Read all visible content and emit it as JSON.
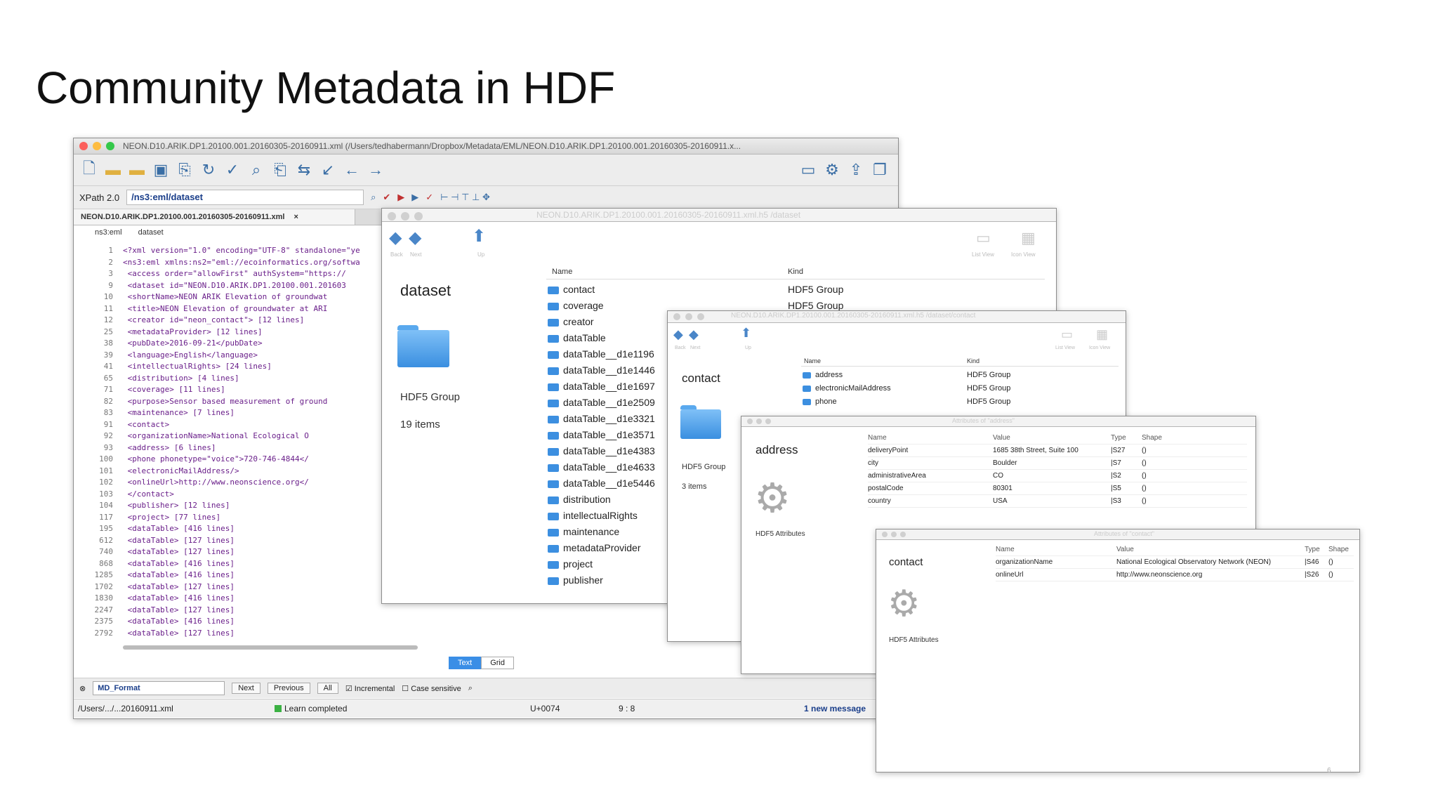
{
  "slide": {
    "title": "Community Metadata in HDF",
    "page_number": "6"
  },
  "editor": {
    "window_title": "NEON.D10.ARIK.DP1.20100.001.20160305-20160911.xml (/Users/tedhabermann/Dropbox/Metadata/EML/NEON.D10.ARIK.DP1.20100.001.20160305-20160911.x...",
    "toolbar_icons": [
      "new-file-icon",
      "open-folder-icon",
      "open-folder2-icon",
      "save-icon",
      "revert-icon",
      "reload-icon",
      "spellcheck-icon",
      "search-icon",
      "find-in-files-icon",
      "find-replace-icon",
      "format-icon",
      "undo-icon",
      "redo-icon",
      "layout-icon",
      "preferences-icon",
      "export-icon",
      "window-icon"
    ],
    "xpath_version": "XPath 2.0",
    "xpath_value": "/ns3:eml/dataset",
    "file_tab": "NEON.D10.ARIK.DP1.20100.001.20160305-20160911.xml",
    "breadcrumb": [
      "ns3:eml",
      "dataset"
    ],
    "code_lines": [
      {
        "n": "1",
        "t": "<?xml version=\"1.0\" encoding=\"UTF-8\" standalone=\"ye"
      },
      {
        "n": "2",
        "t": "<ns3:eml xmlns:ns2=\"eml://ecoinformatics.org/softwa"
      },
      {
        "n": "3",
        "t": "  <access order=\"allowFirst\" authSystem=\"https://"
      },
      {
        "n": "9",
        "t": "  <dataset id=\"NEON.D10.ARIK.DP1.20100.001.201603"
      },
      {
        "n": "10",
        "t": "    <shortName>NEON ARIK Elevation of groundwat"
      },
      {
        "n": "11",
        "t": "    <title>NEON Elevation of groundwater at ARI"
      },
      {
        "n": "12",
        "t": "    <creator id=\"neon_contact\"> [12 lines]"
      },
      {
        "n": "25",
        "t": "    <metadataProvider> [12 lines]"
      },
      {
        "n": "38",
        "t": "    <pubDate>2016-09-21</pubDate>"
      },
      {
        "n": "39",
        "t": "    <language>English</language>"
      },
      {
        "n": "41",
        "t": "    <intellectualRights> [24 lines]"
      },
      {
        "n": "65",
        "t": "    <distribution> [4 lines]"
      },
      {
        "n": "71",
        "t": "    <coverage> [11 lines]"
      },
      {
        "n": "82",
        "t": "    <purpose>Sensor based measurement of ground"
      },
      {
        "n": "83",
        "t": "    <maintenance> [7 lines]"
      },
      {
        "n": "91",
        "t": "    <contact>"
      },
      {
        "n": "92",
        "t": "      <organizationName>National Ecological O"
      },
      {
        "n": "93",
        "t": "      <address> [6 lines]"
      },
      {
        "n": "100",
        "t": "      <phone phonetype=\"voice\">720-746-4844</"
      },
      {
        "n": "101",
        "t": "      <electronicMailAddress/>"
      },
      {
        "n": "102",
        "t": "      <onlineUrl>http://www.neonscience.org</"
      },
      {
        "n": "103",
        "t": "    </contact>"
      },
      {
        "n": "104",
        "t": "    <publisher> [12 lines]"
      },
      {
        "n": "117",
        "t": "    <project> [77 lines]"
      },
      {
        "n": "195",
        "t": "    <dataTable> [416 lines]"
      },
      {
        "n": "612",
        "t": "    <dataTable> [127 lines]"
      },
      {
        "n": "740",
        "t": "    <dataTable> [127 lines]"
      },
      {
        "n": "868",
        "t": "    <dataTable> [416 lines]"
      },
      {
        "n": "1285",
        "t": "    <dataTable> [416 lines]"
      },
      {
        "n": "1702",
        "t": "    <dataTable> [127 lines]"
      },
      {
        "n": "1830",
        "t": "    <dataTable> [416 lines]"
      },
      {
        "n": "2247",
        "t": "    <dataTable> [127 lines]"
      },
      {
        "n": "2375",
        "t": "    <dataTable> [416 lines]"
      },
      {
        "n": "2792",
        "t": "    <dataTable> [127 lines]"
      }
    ],
    "view_text": "Text",
    "view_grid": "Grid",
    "find_value": "MD_Format",
    "find_next": "Next",
    "find_previous": "Previous",
    "find_all": "All",
    "incremental": "Incremental",
    "case_sensitive": "Case sensitive",
    "status_path": "/Users/.../...20160911.xml",
    "status_learn": "Learn completed",
    "status_unicode": "U+0074",
    "status_pos": "9 : 8",
    "status_messages": "1 new message"
  },
  "dataset_window": {
    "title": "NEON.D10.ARIK.DP1.20100.001.20160305-20160911.xml.h5 /dataset",
    "back": "Back",
    "next": "Next",
    "up": "Up",
    "list_view": "List View",
    "icon_view": "Icon View",
    "name": "dataset",
    "type": "HDF5 Group",
    "count": "19 items",
    "col_name": "Name",
    "col_kind": "Kind",
    "items": [
      {
        "name": "contact",
        "kind": "HDF5 Group"
      },
      {
        "name": "coverage",
        "kind": "HDF5 Group"
      },
      {
        "name": "creator",
        "kind": ""
      },
      {
        "name": "dataTable",
        "kind": ""
      },
      {
        "name": "dataTable__d1e1196",
        "kind": ""
      },
      {
        "name": "dataTable__d1e1446",
        "kind": ""
      },
      {
        "name": "dataTable__d1e1697",
        "kind": ""
      },
      {
        "name": "dataTable__d1e2509",
        "kind": ""
      },
      {
        "name": "dataTable__d1e3321",
        "kind": ""
      },
      {
        "name": "dataTable__d1e3571",
        "kind": ""
      },
      {
        "name": "dataTable__d1e4383",
        "kind": ""
      },
      {
        "name": "dataTable__d1e4633",
        "kind": ""
      },
      {
        "name": "dataTable__d1e5446",
        "kind": ""
      },
      {
        "name": "distribution",
        "kind": ""
      },
      {
        "name": "intellectualRights",
        "kind": ""
      },
      {
        "name": "maintenance",
        "kind": ""
      },
      {
        "name": "metadataProvider",
        "kind": ""
      },
      {
        "name": "project",
        "kind": ""
      },
      {
        "name": "publisher",
        "kind": ""
      }
    ]
  },
  "contact_window": {
    "title": "NEON.D10.ARIK.DP1.20100.001.20160305-20160911.xml.h5 /dataset/contact",
    "back": "Back",
    "next": "Next",
    "up": "Up",
    "list_view": "List View",
    "icon_view": "Icon View",
    "name": "contact",
    "type": "HDF5 Group",
    "count": "3 items",
    "col_name": "Name",
    "col_kind": "Kind",
    "items": [
      {
        "name": "address",
        "kind": "HDF5 Group"
      },
      {
        "name": "electronicMailAddress",
        "kind": "HDF5 Group"
      },
      {
        "name": "phone",
        "kind": "HDF5 Group"
      }
    ]
  },
  "address_window": {
    "title": "Attributes of \"address\"",
    "name": "address",
    "type": "HDF5 Attributes",
    "headers": [
      "Name",
      "Value",
      "Type",
      "Shape"
    ],
    "rows": [
      {
        "name": "deliveryPoint",
        "value": "1685 38th Street, Suite 100",
        "type": "|S27",
        "shape": "()"
      },
      {
        "name": "city",
        "value": "Boulder",
        "type": "|S7",
        "shape": "()"
      },
      {
        "name": "administrativeArea",
        "value": "CO",
        "type": "|S2",
        "shape": "()"
      },
      {
        "name": "postalCode",
        "value": "80301",
        "type": "|S5",
        "shape": "()"
      },
      {
        "name": "country",
        "value": "USA",
        "type": "|S3",
        "shape": "()"
      }
    ]
  },
  "contact_attr_window": {
    "title": "Attributes of \"contact\"",
    "name": "contact",
    "type": "HDF5 Attributes",
    "headers": [
      "Name",
      "Value",
      "Type",
      "Shape"
    ],
    "rows": [
      {
        "name": "organizationName",
        "value": "National Ecological Observatory Network (NEON)",
        "type": "|S46",
        "shape": "()"
      },
      {
        "name": "onlineUrl",
        "value": "http://www.neonscience.org",
        "type": "|S26",
        "shape": "()"
      }
    ]
  }
}
